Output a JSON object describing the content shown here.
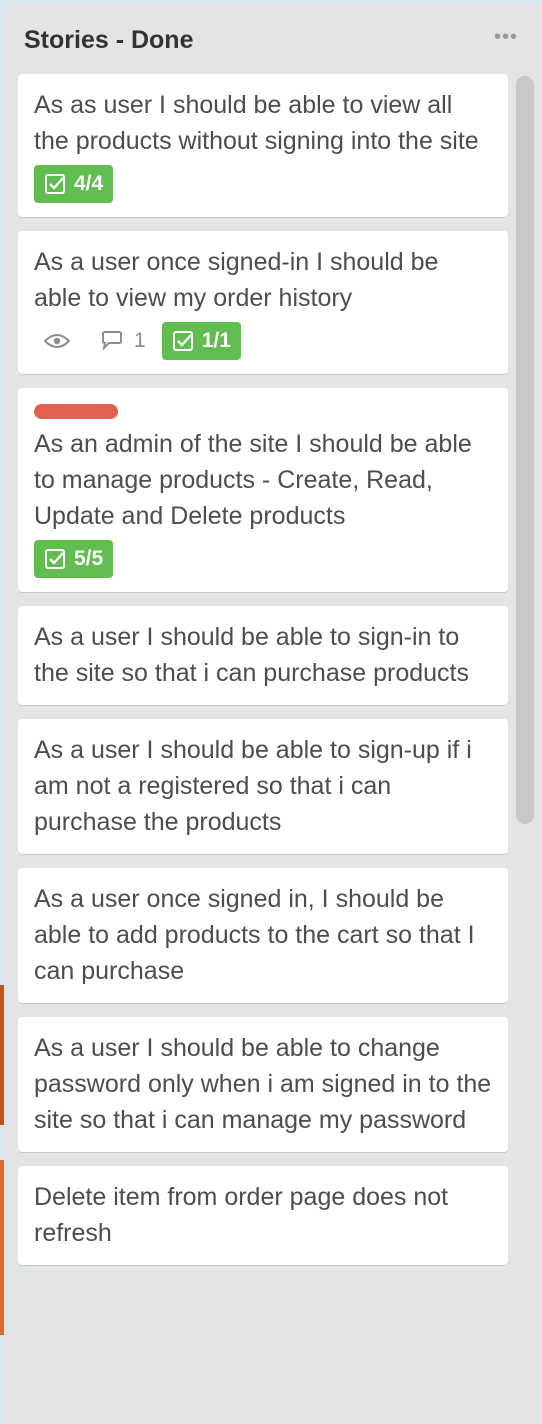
{
  "list": {
    "title": "Stories - Done",
    "more_icon": "•••"
  },
  "icons": {
    "watch": "eye-icon",
    "comment": "comment-icon",
    "checklist": "checklist-icon",
    "more": "more-horizontal-icon"
  },
  "colors": {
    "list_bg": "#e2e4e6",
    "checklist_complete": "#61bd4f",
    "label_red": "#e2604f"
  },
  "cards": [
    {
      "title": "As as user I should be able to view all the products without signing into the site",
      "checklist": "4/4"
    },
    {
      "title": "As a user once signed-in I should be able to view my order history",
      "comments": "1",
      "checklist": "1/1"
    },
    {
      "title": "As an admin of the site I should be able to manage products - Create, Read, Update and Delete products",
      "checklist": "5/5"
    },
    {
      "title": "As a user I should be able to sign-in to the site so that i can purchase products"
    },
    {
      "title": "As a user I should be able to sign-up if i am not a registered so that i can purchase the products"
    },
    {
      "title": "As a user once signed in, I should be able to add products to the cart so that I can purchase"
    },
    {
      "title": "As a user I should be able to change password only when i am signed in to the site so that i can manage my password"
    },
    {
      "title": "Delete item from order page does not refresh"
    }
  ]
}
